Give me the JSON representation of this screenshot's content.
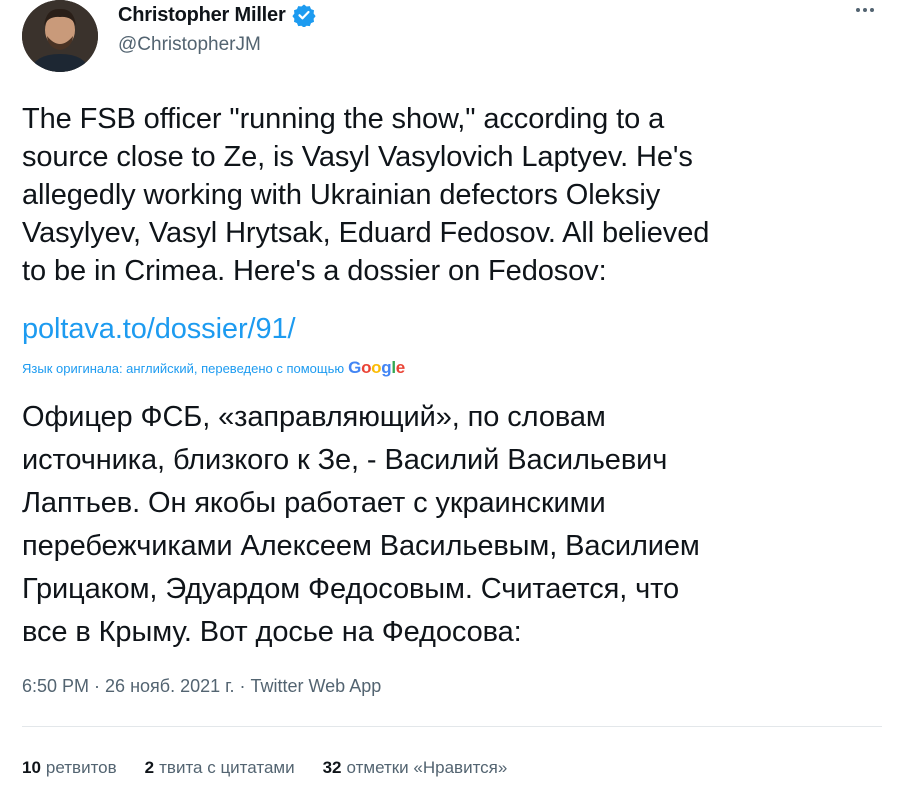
{
  "author": {
    "display_name": "Christopher Miller",
    "handle": "@ChristopherJM",
    "verified": true,
    "avatar_icon": "user-avatar"
  },
  "tweet": {
    "text": "The FSB officer \"running the show,\" according to a\nsource close to Ze, is Vasyl Vasylovich Laptyev. He's\nallegedly working with Ukrainian defectors Oleksiy\nVasylyev, Vasyl Hrytsak, Eduard Fedosov. All believed\nto be in Crimea. Here's a dossier on Fedosov:",
    "link": "poltava.to/dossier/91/"
  },
  "translation": {
    "note": "Язык оригинала: английский, переведено с помощью",
    "provider": "Google",
    "text": "Офицер ФСБ, «заправляющий», по словам\nисточника, близкого к Зе, - Василий Васильевич\nЛаптьев. Он якобы работает с украинскими\nперебежчиками Алексеем Васильевым, Василием\nГрицаком, Эдуардом Федосовым. Считается, что\nвсе в Крыму. Вот досье на Федосова:"
  },
  "meta": {
    "time": "6:50 PM",
    "separator1": "·",
    "date": "26 нояб. 2021 г.",
    "separator2": "·",
    "source": "Twitter Web App"
  },
  "stats": {
    "retweets_count": "10",
    "retweets_label": "ретвитов",
    "quotes_count": "2",
    "quotes_label": "твита с цитатами",
    "likes_count": "32",
    "likes_label": "отметки «Нравится»"
  },
  "colors": {
    "accent": "#1d9bf0",
    "text_primary": "#0f1419",
    "text_secondary": "#536471",
    "divider": "#e3e7ea"
  }
}
